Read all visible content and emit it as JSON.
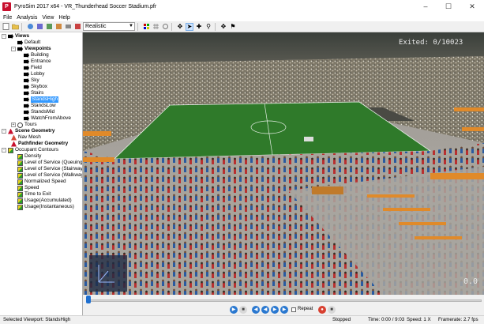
{
  "window": {
    "title": "PyroSim 2017 x64 - VR_Thunderhead Soccer Stadium.pfr",
    "app_icon_letter": "P"
  },
  "menu": [
    "File",
    "Analysis",
    "View",
    "Help"
  ],
  "toolbar": {
    "render_mode": "Realistic"
  },
  "tree": {
    "views_label": "Views",
    "default_label": "Default",
    "viewpoints_label": "Viewpoints",
    "viewpoints": [
      "Building",
      "Entrance",
      "Field",
      "Lobby",
      "Sky",
      "Skybox",
      "Stairs",
      "StandsHigh",
      "StandsLow",
      "StandsMid",
      "WatchFromAbove"
    ],
    "selected_viewpoint": "StandsHigh",
    "tours_label": "Tours",
    "scene_geometry_label": "Scene Geometry",
    "nav_mesh_label": "Nav Mesh",
    "pathfinder_geometry_label": "Pathfinder Geometry",
    "occupant_contours_label": "Occupant Contours",
    "contours": [
      "Density",
      "Level of Service (Queuing)",
      "Level of Service (Stairway)",
      "Level of Service (Walkway)",
      "Normalized Speed",
      "Speed",
      "Time to Exit",
      "Usage(Accumulated)",
      "Usage(Instantaneous)"
    ]
  },
  "viewport": {
    "exited_label": "Exited:",
    "exited_value": "0/10023",
    "time_overlay": "0.0"
  },
  "playback": {
    "repeat_label": "Repeat",
    "progress": 0
  },
  "status": {
    "selected": "Selected Viewport: StandsHigh",
    "state": "Stopped",
    "time": "Time: 0:00 / 9:03",
    "speed": "Speed: 1 X",
    "framerate": "Framerate: 2.7 fps"
  },
  "colors": {
    "accent": "#3399ff",
    "field_green": "#2f7a2a",
    "seat_orange": "#e08a2a"
  }
}
